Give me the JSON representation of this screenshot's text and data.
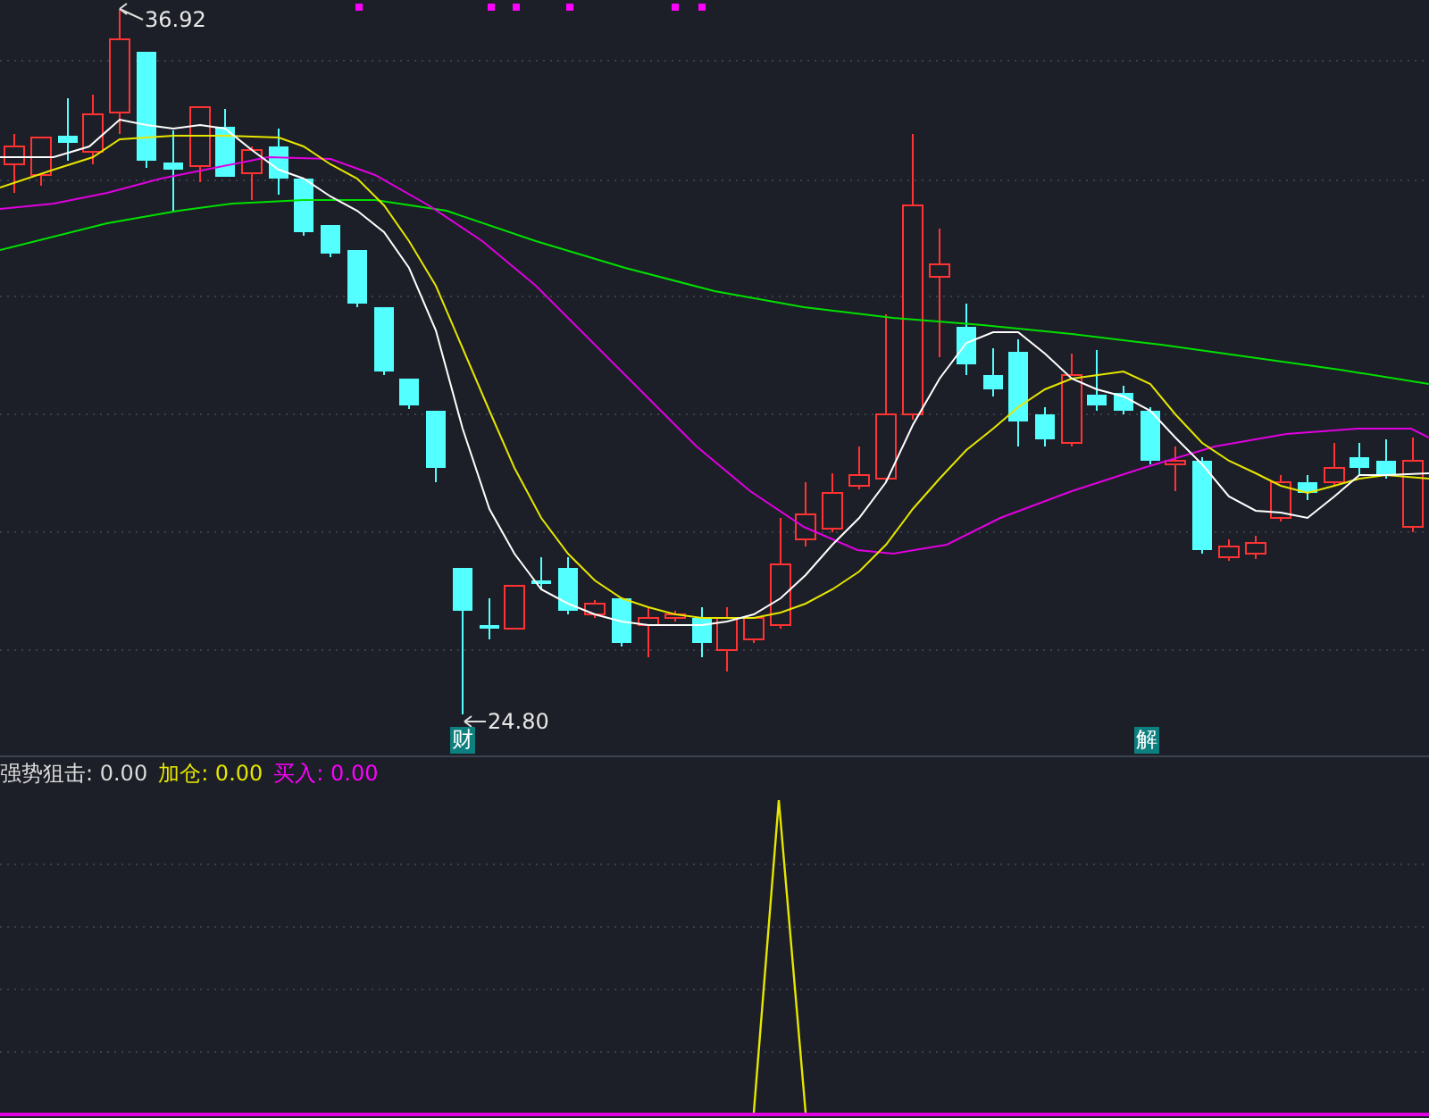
{
  "price_chart": {
    "high_label": "36.92",
    "low_label": "24.80",
    "markers": [
      {
        "text": "财"
      },
      {
        "text": "解"
      }
    ]
  },
  "indicator": {
    "legend": [
      {
        "text": "强势狙击: 0.00",
        "color": "#dcdcdc"
      },
      {
        "text": "加仓: 0.00",
        "color": "#e6e600"
      },
      {
        "text": "买入: 0.00",
        "color": "#ff00ff"
      }
    ]
  }
}
